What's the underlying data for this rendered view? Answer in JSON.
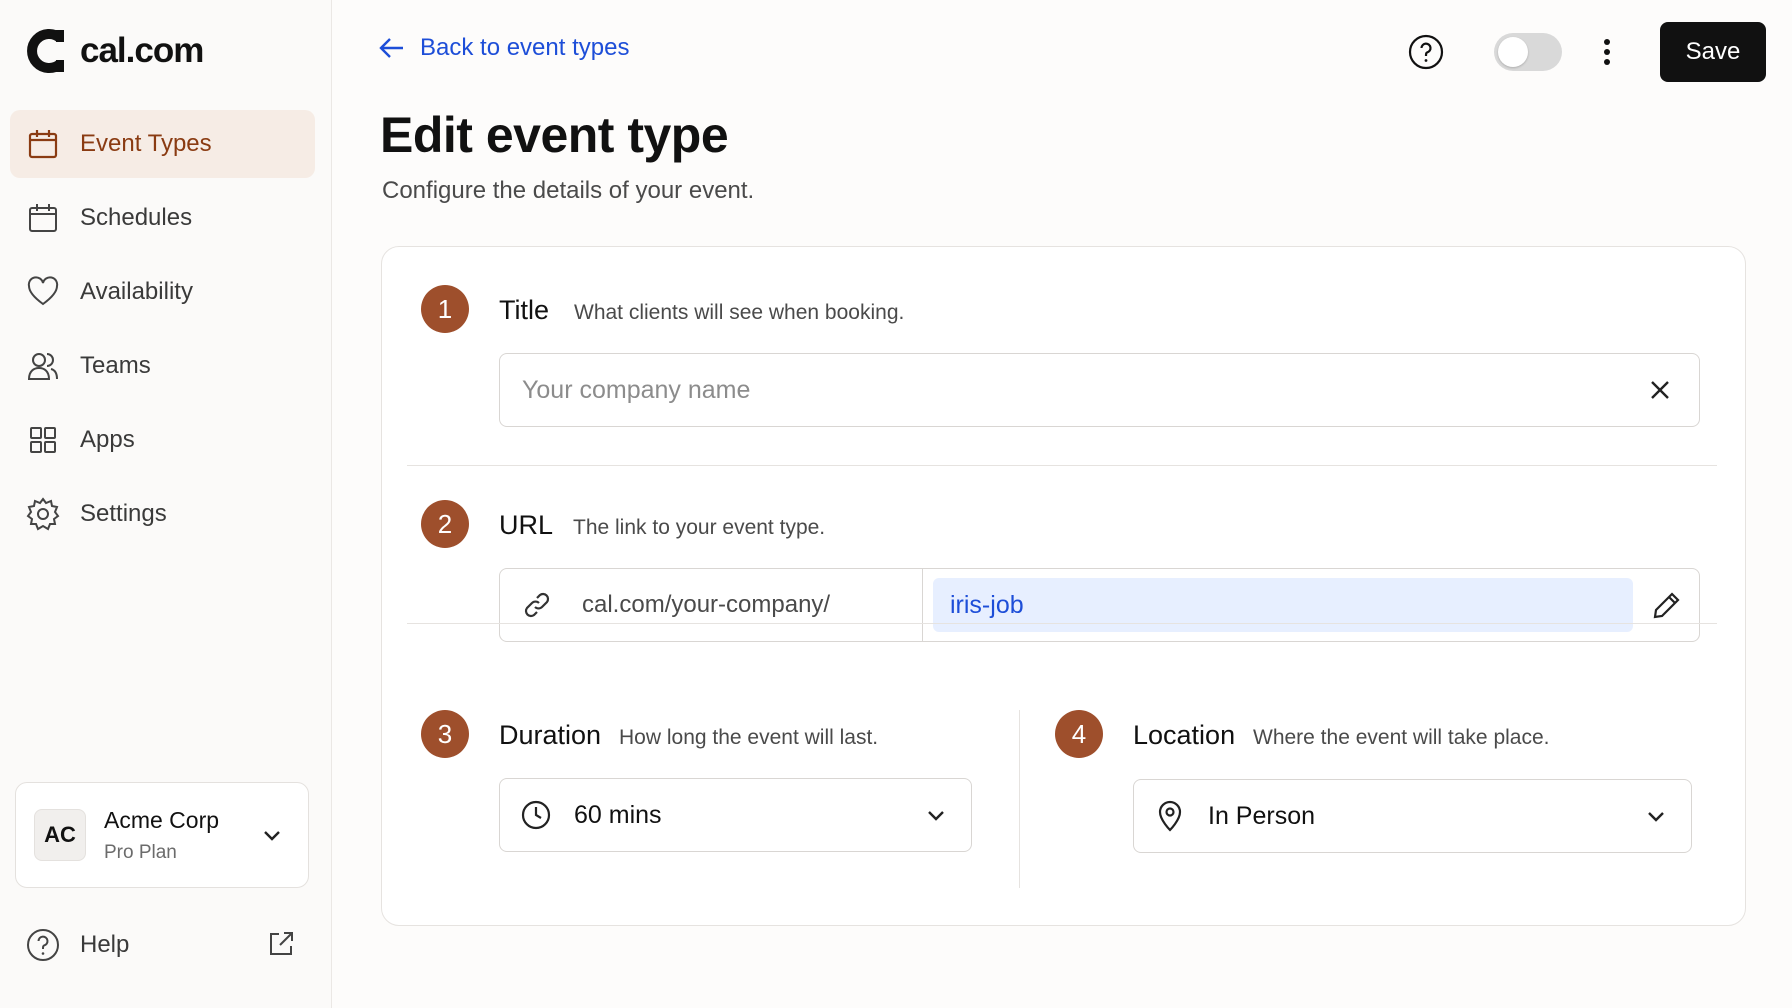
{
  "brand": {
    "name": "cal.com",
    "accent": "#9e4f2c",
    "active_bg": "#f6ece5",
    "link_color": "#1d4ed8"
  },
  "sidebar": {
    "items": [
      {
        "label": "Event Types",
        "icon": "calendar-icon",
        "active": true
      },
      {
        "label": "Schedules",
        "icon": "calendar-icon",
        "active": false
      },
      {
        "label": "Availability",
        "icon": "heart-icon",
        "active": false
      },
      {
        "label": "Teams",
        "icon": "users-icon",
        "active": false
      },
      {
        "label": "Apps",
        "icon": "grid-icon",
        "active": false
      },
      {
        "label": "Settings",
        "icon": "gear-icon",
        "active": false
      }
    ],
    "account": {
      "initials": "AC",
      "name": "Acme Corp",
      "plan": "Pro Plan"
    },
    "help": {
      "label": "Help"
    }
  },
  "header": {
    "back_label": "Back to event types",
    "save_label": "Save",
    "toggle_on": false
  },
  "page": {
    "title": "Edit event type",
    "subtitle": "Configure the details of your event."
  },
  "form": {
    "title": {
      "step": "1",
      "label": "Title",
      "help": "What clients will see when booking.",
      "placeholder": "Your company name",
      "value": ""
    },
    "url": {
      "step": "2",
      "label": "URL",
      "help": "The link to your event type.",
      "prefix": "cal.com/your-company/",
      "slug": "iris-job"
    },
    "duration": {
      "step": "3",
      "label": "Duration",
      "help": "How long the event will last.",
      "value": "60 mins"
    },
    "location": {
      "step": "4",
      "label": "Location",
      "help": "Where the event will take place.",
      "value": "In Person"
    }
  }
}
